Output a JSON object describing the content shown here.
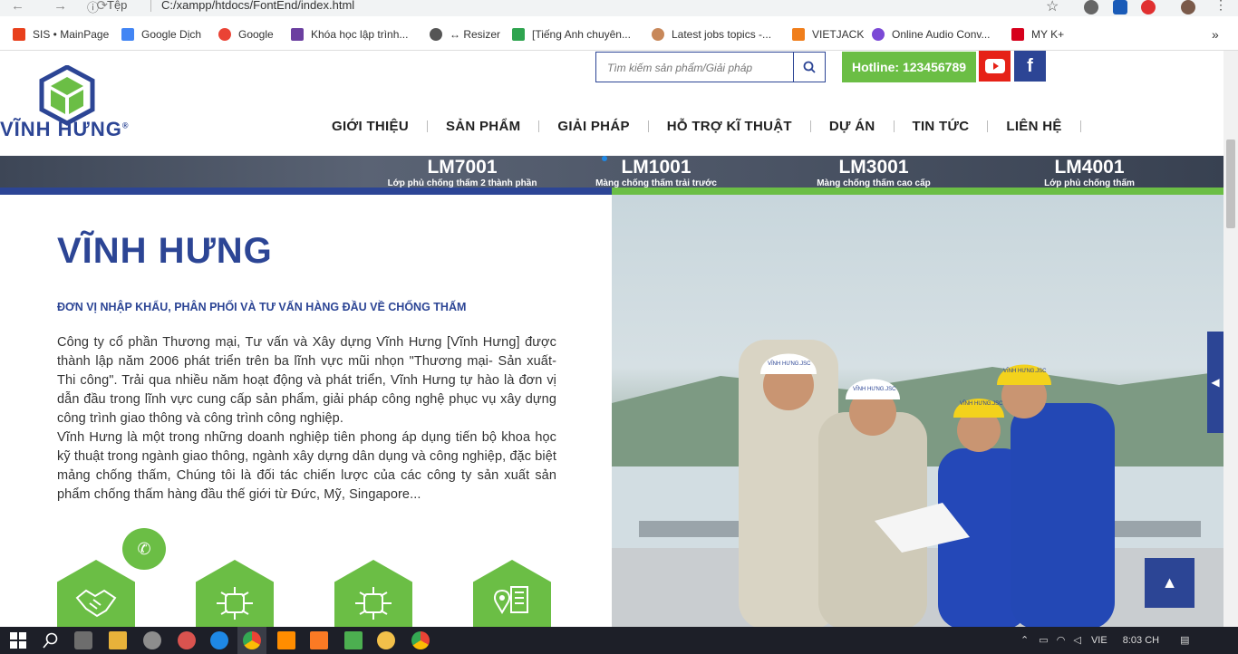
{
  "browser": {
    "nav_glyphs": "← → ⟳",
    "info_label": "Tệp",
    "url": "C:/xampp/htdocs/FontEnd/index.html",
    "star": "☆",
    "bookmarks": [
      {
        "label": "SIS • MainPage",
        "color": "#e8401c"
      },
      {
        "label": "Google Dịch",
        "color": "#4285f4"
      },
      {
        "label": "Google",
        "color": "#ea4335"
      },
      {
        "label": "Khóa học lập trình...",
        "color": "#6b3fa0"
      },
      {
        "label": "↔ Resizer",
        "color": "#555555"
      },
      {
        "label": "[Tiếng Anh chuyên...",
        "color": "#2ea44f"
      },
      {
        "label": "Latest jobs topics -...",
        "color": "#c8885a"
      },
      {
        "label": "VIETJACK",
        "color": "#f07e1b"
      },
      {
        "label": "Online Audio Conv...",
        "color": "#7b49d6"
      },
      {
        "label": "MY K+",
        "color": "#d6001c"
      }
    ],
    "more": "»"
  },
  "site": {
    "brand": "VĨNH HƯNG",
    "brand_mark": "®",
    "search_placeholder": "Tìm kiếm sản phẩm/Giải pháp",
    "hotline": "Hotline: 123456789",
    "fb_glyph": "f",
    "menu": [
      "GIỚI THIỆU",
      "SẢN PHẨM",
      "GIẢI PHÁP",
      "HỖ TRỢ KĨ THUẬT",
      "DỰ ÁN",
      "TIN TỨC",
      "LIÊN HỆ"
    ],
    "products": [
      {
        "code": "LM7001",
        "desc": "Lớp phủ chống thấm 2 thành phần"
      },
      {
        "code": "LM1001",
        "desc": "Màng chống thấm trải trước"
      },
      {
        "code": "LM3001",
        "desc": "Màng chống thấm cao cấp"
      },
      {
        "code": "LM4001",
        "desc": "Lớp phủ chống thấm"
      }
    ],
    "heading": "VĨNH HƯNG",
    "subheading": "ĐƠN VỊ NHẬP KHẨU, PHÂN PHỐI VÀ TƯ VẤN HÀNG ĐẦU VỀ CHỐNG THẤM",
    "paragraph1": "Công ty cổ phần Thương mại, Tư vấn và Xây dựng Vĩnh Hưng [Vĩnh Hưng] được thành lập năm 2006 phát triển trên ba lĩnh vực mũi nhọn \"Thương mại- Sản xuất- Thi công\". Trải qua nhiều năm hoạt động và phát triển, Vĩnh Hưng tự hào là đơn vị dẫn đầu trong lĩnh vực cung cấp sản phẩm, giải pháp công nghệ phục vụ xây dựng công trình giao thông và công trình công nghiệp.",
    "paragraph2": "Vĩnh Hưng là một trong những doanh nghiệp tiên phong áp dụng tiến bộ khoa học kỹ thuật trong ngành giao thông, ngành xây dựng dân dụng và công nghiệp, đặc biệt mảng chống thấm, Chúng tôi là đối tác chiến lược của các công ty sản xuất sản phẩm chống thấm hàng đầu thế giới từ Đức, Mỹ, Singapore...",
    "phone_glyph": "✆",
    "side_glyph": "◀",
    "up_glyph": "▲",
    "helmet_label": "VĨNH HƯNG.JSC"
  },
  "taskbar": {
    "lang": "VIE",
    "time": "8:03 CH"
  },
  "colors": {
    "blue": "#2c4595",
    "green": "#6bbe45",
    "red": "#e62117"
  }
}
